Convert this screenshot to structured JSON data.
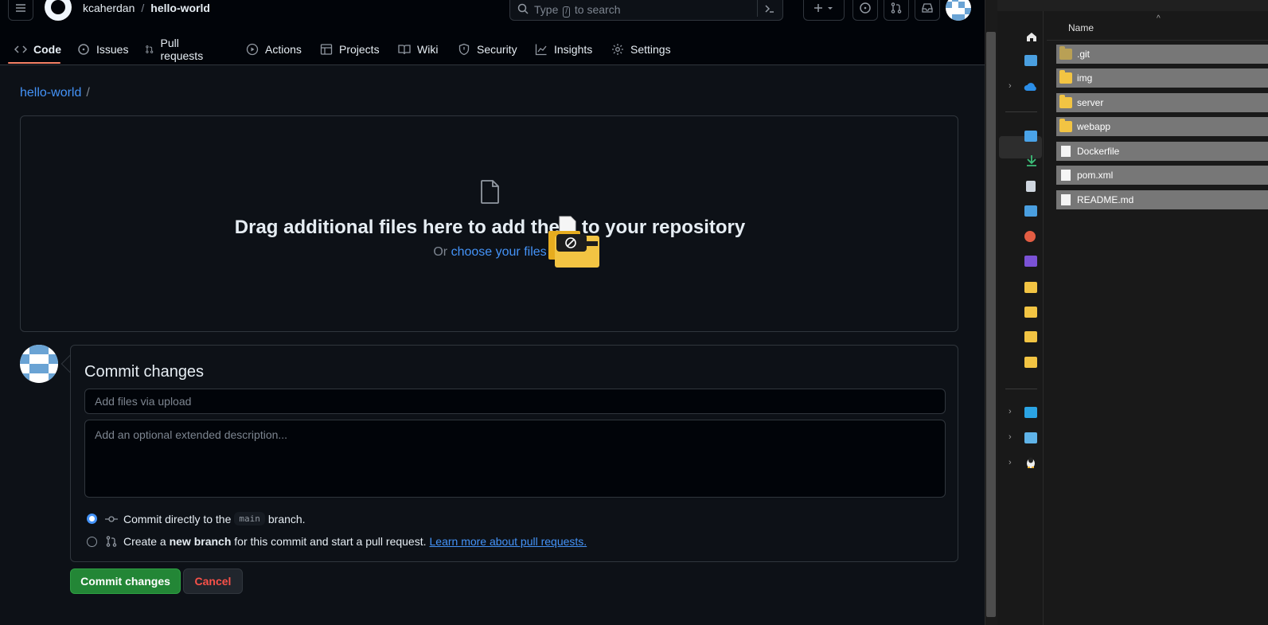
{
  "github": {
    "owner": "kcaherdan",
    "repo": "hello-world",
    "search_placeholder_prefix": "Type",
    "search_key": "/",
    "search_placeholder_suffix": "to search",
    "tabs": [
      {
        "label": "Code",
        "icon": "code-icon"
      },
      {
        "label": "Issues",
        "icon": "issue-icon"
      },
      {
        "label": "Pull requests",
        "icon": "pull-request-icon"
      },
      {
        "label": "Actions",
        "icon": "play-icon"
      },
      {
        "label": "Projects",
        "icon": "table-icon"
      },
      {
        "label": "Wiki",
        "icon": "book-icon"
      },
      {
        "label": "Security",
        "icon": "shield-icon"
      },
      {
        "label": "Insights",
        "icon": "graph-icon"
      },
      {
        "label": "Settings",
        "icon": "gear-icon"
      }
    ],
    "breadcrumb": {
      "repo": "hello-world",
      "sep": "/"
    },
    "dropzone": {
      "title": "Drag additional files here to add them to your repository",
      "sub_prefix": "Or",
      "sub_link": "choose your files"
    },
    "commit": {
      "title": "Commit changes",
      "message_placeholder": "Add files via upload",
      "description_placeholder": "Add an optional extended description...",
      "option_direct_prefix": "Commit directly to the",
      "option_direct_branch": "main",
      "option_direct_suffix": "branch.",
      "option_new_prefix": "Create a",
      "option_new_bold": "new branch",
      "option_new_suffix": "for this commit and start a pull request.",
      "option_new_link": "Learn more about pull requests.",
      "selected": "direct"
    },
    "buttons": {
      "commit": "Commit changes",
      "cancel": "Cancel"
    },
    "colors": {
      "link": "#4493f8",
      "primary": "#238636",
      "danger": "#f85149",
      "tab_underline": "#f78166"
    }
  },
  "explorer": {
    "column_header": "Name",
    "files": [
      {
        "name": ".git",
        "type": "folder"
      },
      {
        "name": "img",
        "type": "folder"
      },
      {
        "name": "server",
        "type": "folder"
      },
      {
        "name": "webapp",
        "type": "folder"
      },
      {
        "name": "Dockerfile",
        "type": "file"
      },
      {
        "name": "pom.xml",
        "type": "file"
      },
      {
        "name": "README.md",
        "type": "file"
      }
    ]
  }
}
